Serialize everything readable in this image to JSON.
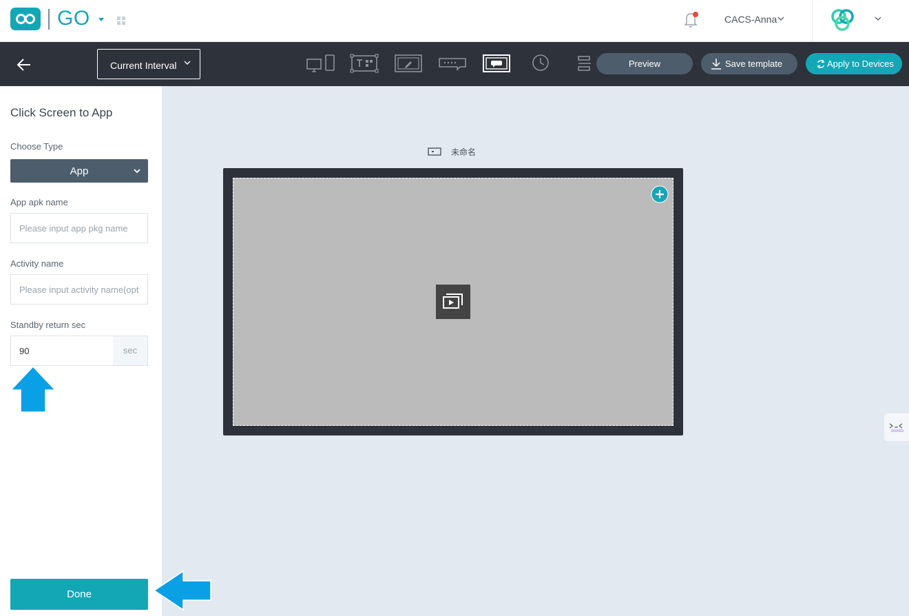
{
  "header": {
    "app_name": "GO",
    "user_name": "CACS-Anna",
    "icons": [
      "infinity-logo-icon",
      "apps-grid-icon",
      "bell-icon",
      "chevron-down-icon",
      "brand-logo-icon"
    ],
    "colors": {
      "accent": "#13a7b6",
      "notification": "#e64b3c"
    }
  },
  "toolbar": {
    "interval_label": "Current Interval",
    "tools": [
      "screen-layout-icon",
      "text-qr-icon",
      "edit-canvas-icon",
      "marquee-icon",
      "message-icon",
      "clock-icon",
      "align-icon"
    ],
    "preview_label": "Preview",
    "save_label": "Save template",
    "apply_label": "Apply to Devices",
    "colors": {
      "bar": "#2e323a",
      "button": "#4e5d6c",
      "primary": "#13a7b6"
    }
  },
  "panel": {
    "title": "Click Screen to App",
    "choose_type_label": "Choose Type",
    "type_value": "App",
    "apk_label": "App apk name",
    "apk_placeholder": "Please input app pkg name",
    "activity_label": "Activity name",
    "activity_placeholder": "Please input activity name(opt",
    "standby_label": "Standby return sec",
    "standby_value": "90",
    "standby_unit": "sec",
    "done_label": "Done"
  },
  "canvas": {
    "screen_name": "未命名"
  }
}
